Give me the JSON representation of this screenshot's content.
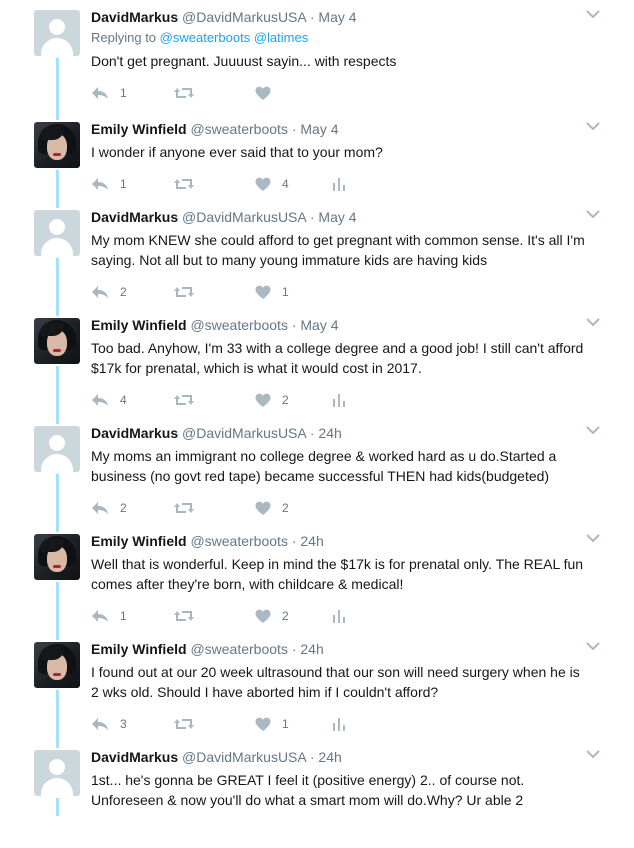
{
  "thread": {
    "tweets": [
      {
        "name": "DavidMarkus",
        "handle": "@DavidMarkusUSA",
        "dot": "·",
        "time": "May 4",
        "replying_label": "Replying to",
        "replying_to": [
          "@sweaterboots",
          "@latimes"
        ],
        "text_lines": [
          "Don't get pregnant. Juuuust sayin... with respects"
        ],
        "reply_count": "1",
        "retweet_count": "",
        "like_count": "",
        "avatar": "default-avatar"
      },
      {
        "name": "Emily Winfield",
        "handle": "@sweaterboots",
        "dot": "·",
        "time": "May 4",
        "text_lines": [
          "I wonder if anyone ever said that to your mom?"
        ],
        "reply_count": "1",
        "retweet_count": "",
        "like_count": "4",
        "avatar": "photo-avatar"
      },
      {
        "name": "DavidMarkus",
        "handle": "@DavidMarkusUSA",
        "dot": "·",
        "time": "May 4",
        "text_lines": [
          "My mom KNEW she could afford to get pregnant with common sense. It's all I'm",
          "saying. Not all but to many young immature kids are having kids"
        ],
        "reply_count": "2",
        "retweet_count": "",
        "like_count": "1",
        "avatar": "default-avatar"
      },
      {
        "name": "Emily Winfield",
        "handle": "@sweaterboots",
        "dot": "·",
        "time": "May 4",
        "text_lines": [
          "Too bad. Anyhow, I'm 33 with a college degree and a good job!  I still can't afford",
          "$17k for prenatal, which is what it would cost in 2017."
        ],
        "reply_count": "4",
        "retweet_count": "",
        "like_count": "2",
        "avatar": "photo-avatar"
      },
      {
        "name": "DavidMarkus",
        "handle": "@DavidMarkusUSA",
        "dot": "·",
        "time": "24h",
        "text_lines": [
          "My moms an immigrant no college degree & worked hard as u do.Started a",
          "business (no govt red tape) became successful THEN had kids(budgeted)"
        ],
        "reply_count": "2",
        "retweet_count": "",
        "like_count": "2",
        "avatar": "default-avatar"
      },
      {
        "name": "Emily Winfield",
        "handle": "@sweaterboots",
        "dot": "·",
        "time": "24h",
        "text_lines": [
          "Well that is wonderful. Keep in mind the $17k is for prenatal only. The REAL fun",
          "comes after they're born, with childcare & medical!"
        ],
        "reply_count": "1",
        "retweet_count": "",
        "like_count": "2",
        "avatar": "photo-avatar"
      },
      {
        "name": "Emily Winfield",
        "handle": "@sweaterboots",
        "dot": "·",
        "time": "24h",
        "text_lines": [
          "I found out at our 20 week ultrasound that our son will need surgery  when he is",
          "2 wks old. Should I have aborted him if I couldn't afford?"
        ],
        "reply_count": "3",
        "retweet_count": "",
        "like_count": "1",
        "avatar": "photo-avatar"
      },
      {
        "name": "DavidMarkus",
        "handle": "@DavidMarkusUSA",
        "dot": "·",
        "time": "24h",
        "text_lines": [
          "1st... he's gonna be GREAT I feel it (positive energy) 2.. of course not.",
          "Unforeseen & now you'll do what a smart mom will do.Why? Ur able 2"
        ],
        "avatar": "default-avatar"
      }
    ]
  },
  "icons": {
    "reply": "reply-icon",
    "retweet": "retweet-icon",
    "like": "heart-icon",
    "analytics": "analytics-icon",
    "more": "chevron-down-icon"
  },
  "colors": {
    "thread_line": "#a3e2f5",
    "action_icon": "#aab8c2",
    "mention": "#1da1f2",
    "secondary_text": "#657786"
  }
}
